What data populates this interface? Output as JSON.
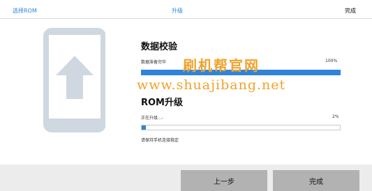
{
  "steps": [
    {
      "label": "选择ROM"
    },
    {
      "label": "升级"
    },
    {
      "label": "完成"
    }
  ],
  "verify": {
    "title": "数据校验",
    "status": "数据准备完毕",
    "percent_text": "100%",
    "progress": 1.0
  },
  "upgrade": {
    "title": "ROM升级",
    "status": "正在升级...-",
    "percent_text": "2%",
    "progress": 0.02,
    "hint": "请保持手机连接稳定"
  },
  "watermark": {
    "cn": "刷机帮官网",
    "url": "www.shuajibang.net"
  },
  "buttons": {
    "prev": "上一步",
    "done": "完成"
  },
  "colors": {
    "accent": "#2f84d8",
    "phone": "#cfd8e0",
    "watermark": "#f0a22a",
    "button": "#b2b2b2"
  },
  "icons": {
    "phone": "phone-upgrade-arrow-icon"
  }
}
